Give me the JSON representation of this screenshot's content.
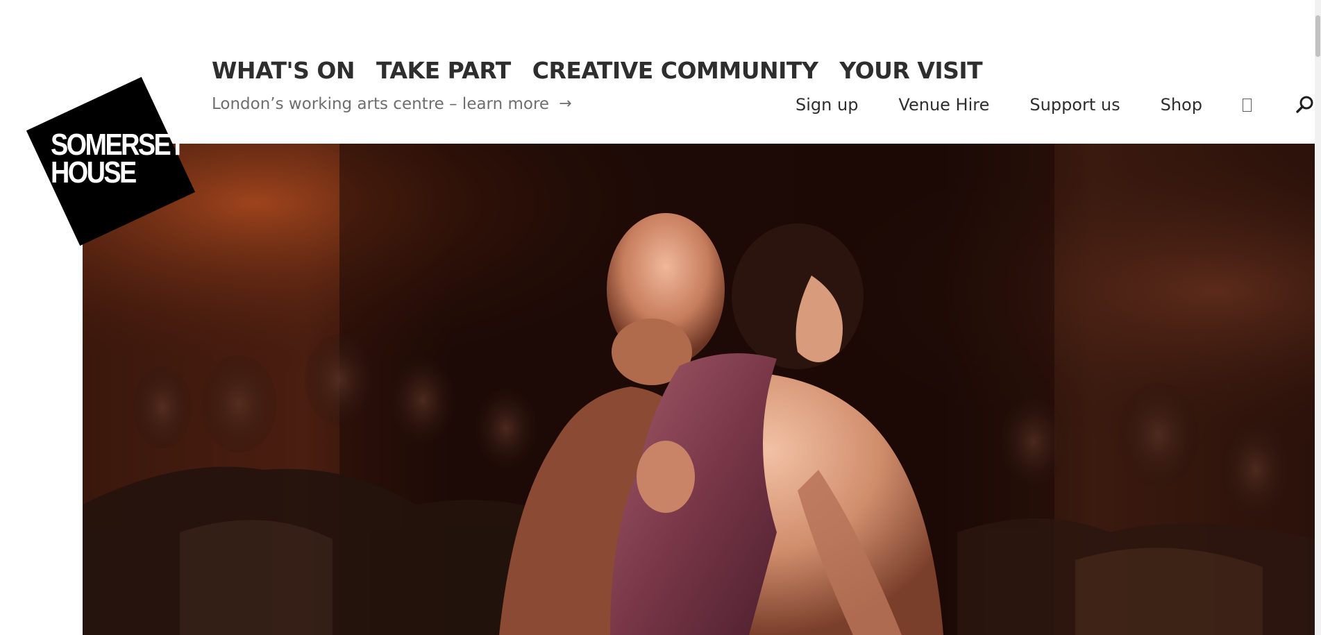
{
  "logo": {
    "text_line1": "SOMERSET",
    "text_line2": "HOUSE"
  },
  "primary_nav": [
    {
      "label": "WHAT'S ON"
    },
    {
      "label": "TAKE PART"
    },
    {
      "label": "CREATIVE COMMUNITY"
    },
    {
      "label": "YOUR VISIT"
    }
  ],
  "tagline": {
    "text": "London’s working arts centre – learn more",
    "arrow": "→"
  },
  "secondary_nav": [
    {
      "label": "Sign up"
    },
    {
      "label": "Venue Hire"
    },
    {
      "label": "Support us"
    },
    {
      "label": "Shop"
    }
  ],
  "icons": {
    "box": "box-icon",
    "search": "search-icon"
  },
  "colors": {
    "text_dark": "#2e2e2e",
    "text_muted": "#6e6e6e",
    "logo_bg": "#000000",
    "hero_bg": "#1a0c08"
  }
}
